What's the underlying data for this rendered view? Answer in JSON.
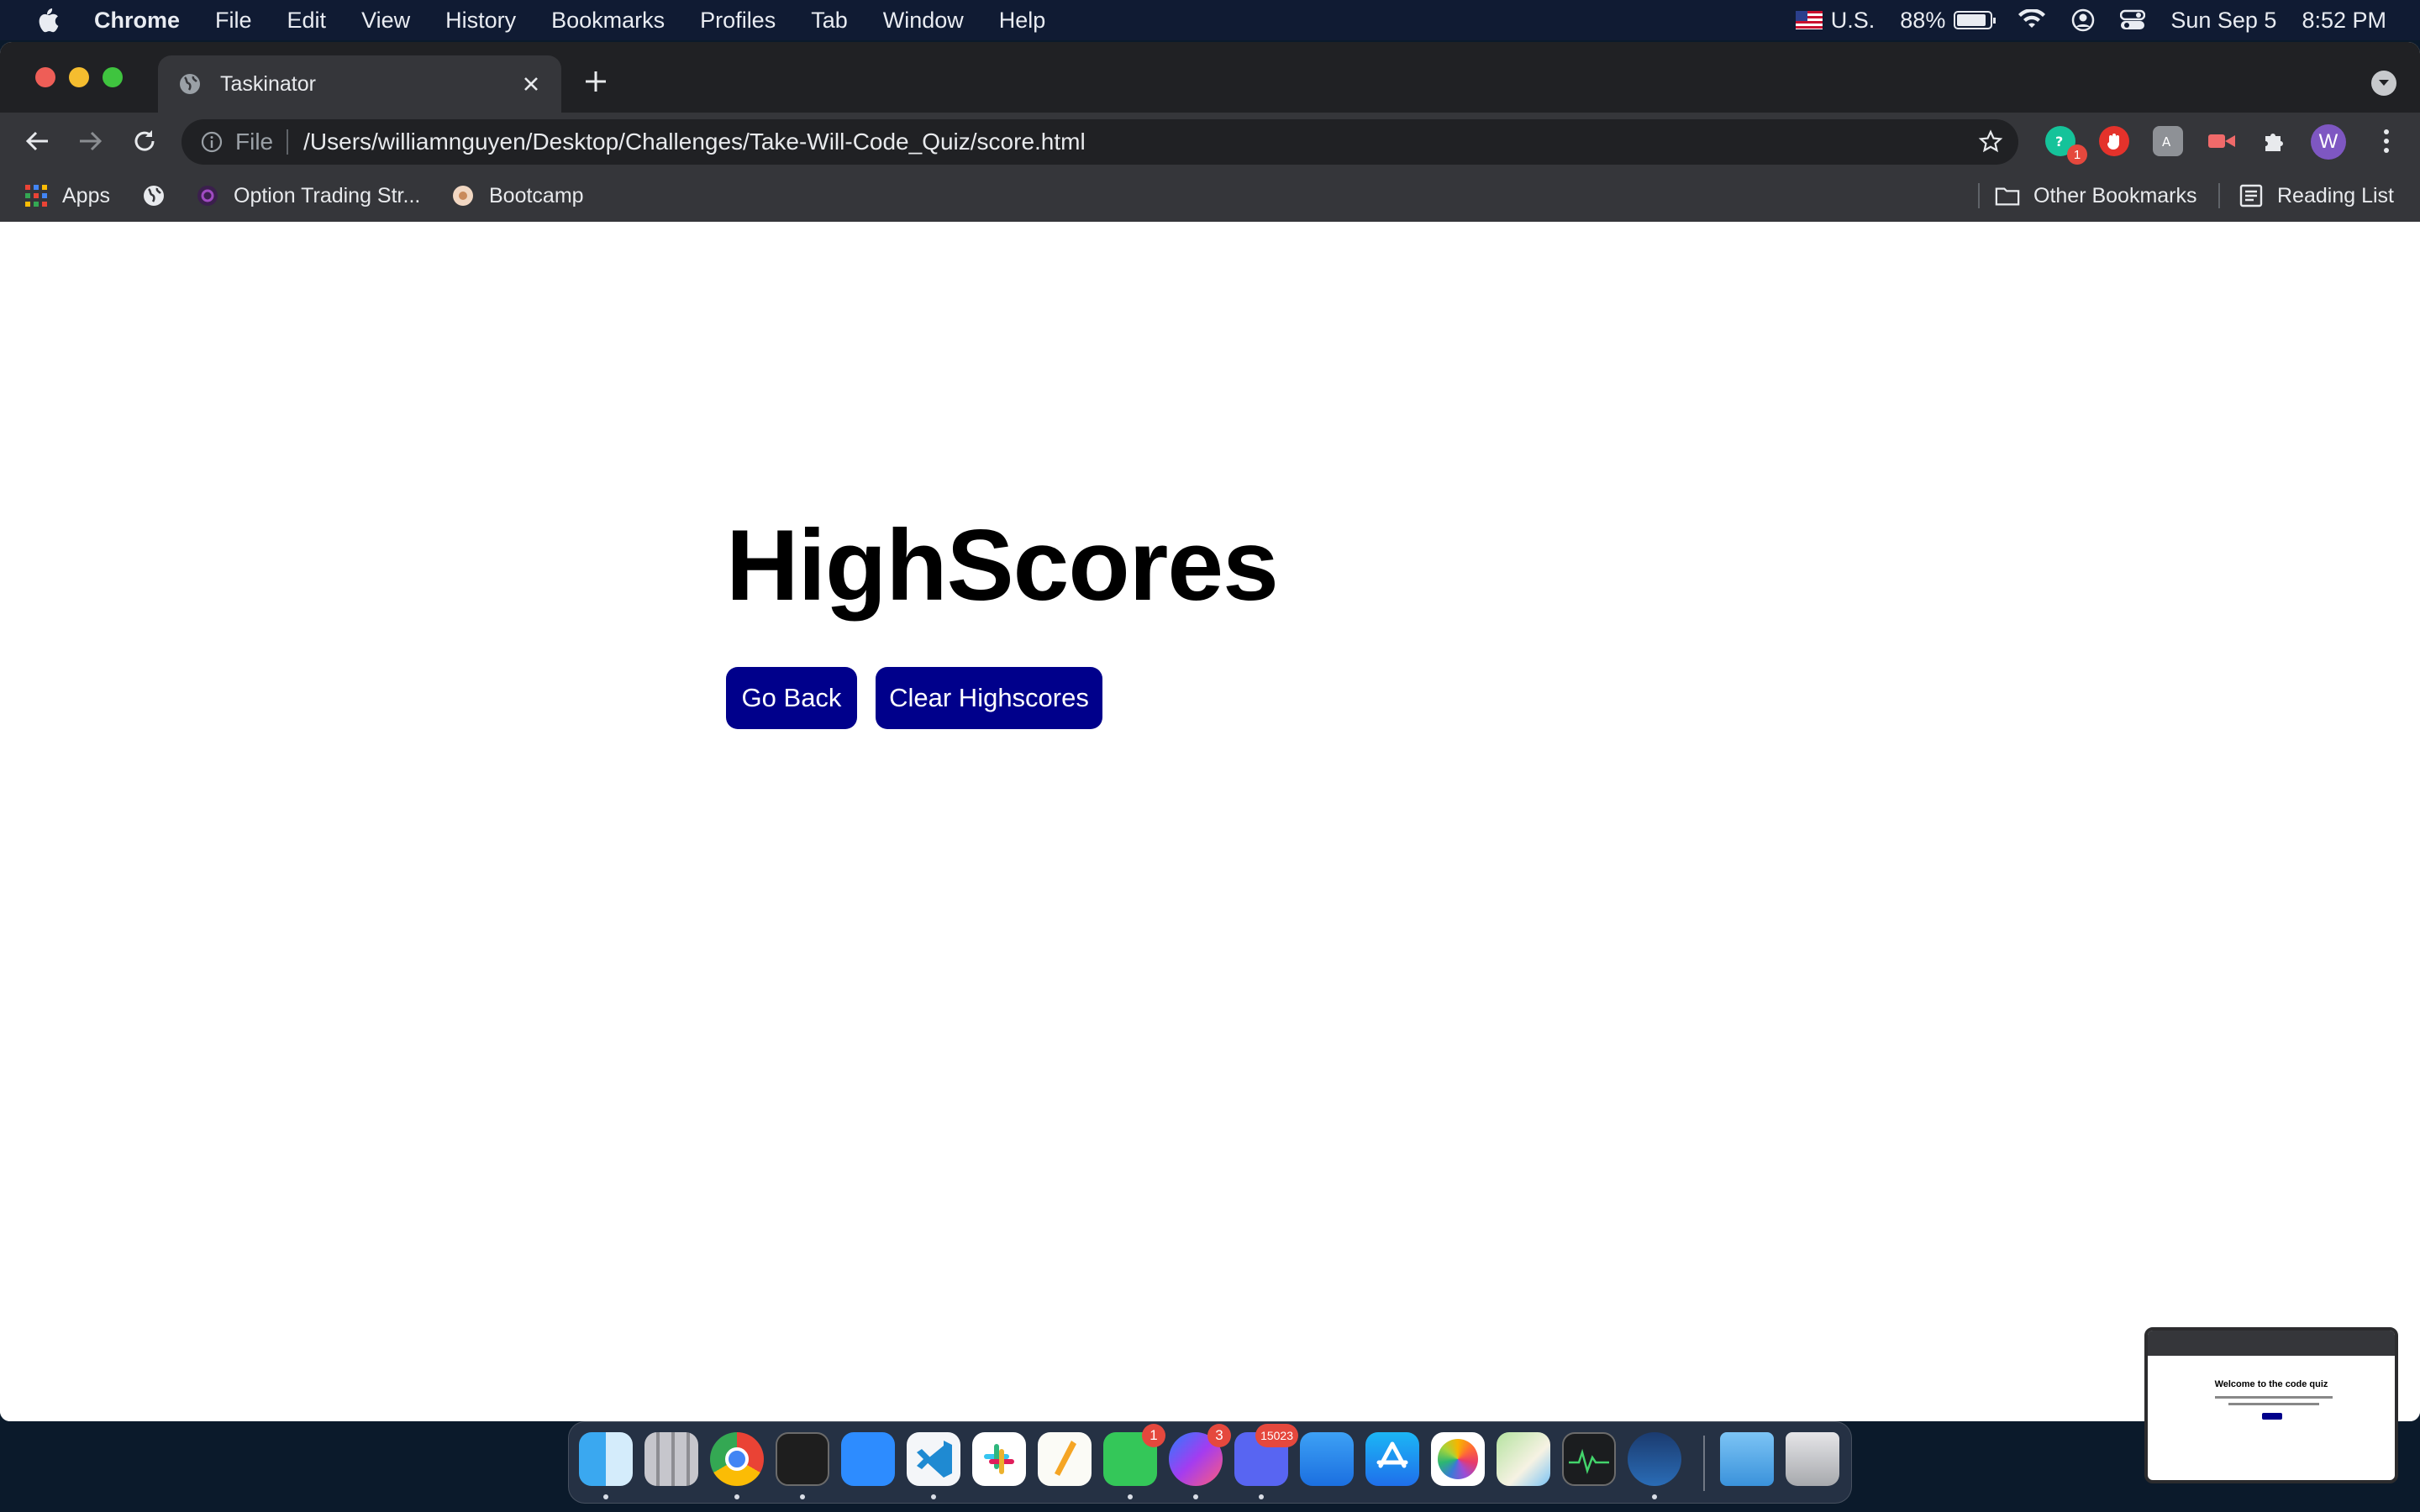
{
  "menubar": {
    "app_name": "Chrome",
    "items": [
      "File",
      "Edit",
      "View",
      "History",
      "Bookmarks",
      "Profiles",
      "Tab",
      "Window",
      "Help"
    ],
    "input_source": "U.S.",
    "battery_percent": "88%",
    "date": "Sun Sep 5",
    "time": "8:52 PM"
  },
  "tab": {
    "title": "Taskinator"
  },
  "omnibox": {
    "scheme_label": "File",
    "url": "/Users/williamnguyen/Desktop/Challenges/Take-Will-Code_Quiz/score.html"
  },
  "extensions": {
    "grammarly_badge": "1"
  },
  "profile": {
    "initial": "W"
  },
  "bookmarks": {
    "items": [
      "Apps",
      "Option Trading Str...",
      "Bootcamp"
    ],
    "other": "Other Bookmarks",
    "reading_list": "Reading List"
  },
  "page": {
    "heading": "HighScores",
    "go_back_label": "Go Back",
    "clear_label": "Clear Highscores"
  },
  "dock": {
    "apps": [
      "finder",
      "launchpad",
      "chrome",
      "terminal",
      "zoom",
      "vscode",
      "slack",
      "pages",
      "messages",
      "messenger",
      "discord",
      "mail",
      "app-store",
      "photos",
      "maps",
      "activity-monitor",
      "steam",
      "downloads",
      "trash"
    ],
    "badges": {
      "messages": "1",
      "messenger": "3",
      "discord": "15023"
    }
  },
  "thumbnail": {
    "title": "Welcome to the code quiz"
  },
  "colors": {
    "button_bg": "#00008b",
    "menubar_bg": "#101b33",
    "tab_strip_bg": "#202124",
    "toolbar_bg": "#35363a"
  }
}
